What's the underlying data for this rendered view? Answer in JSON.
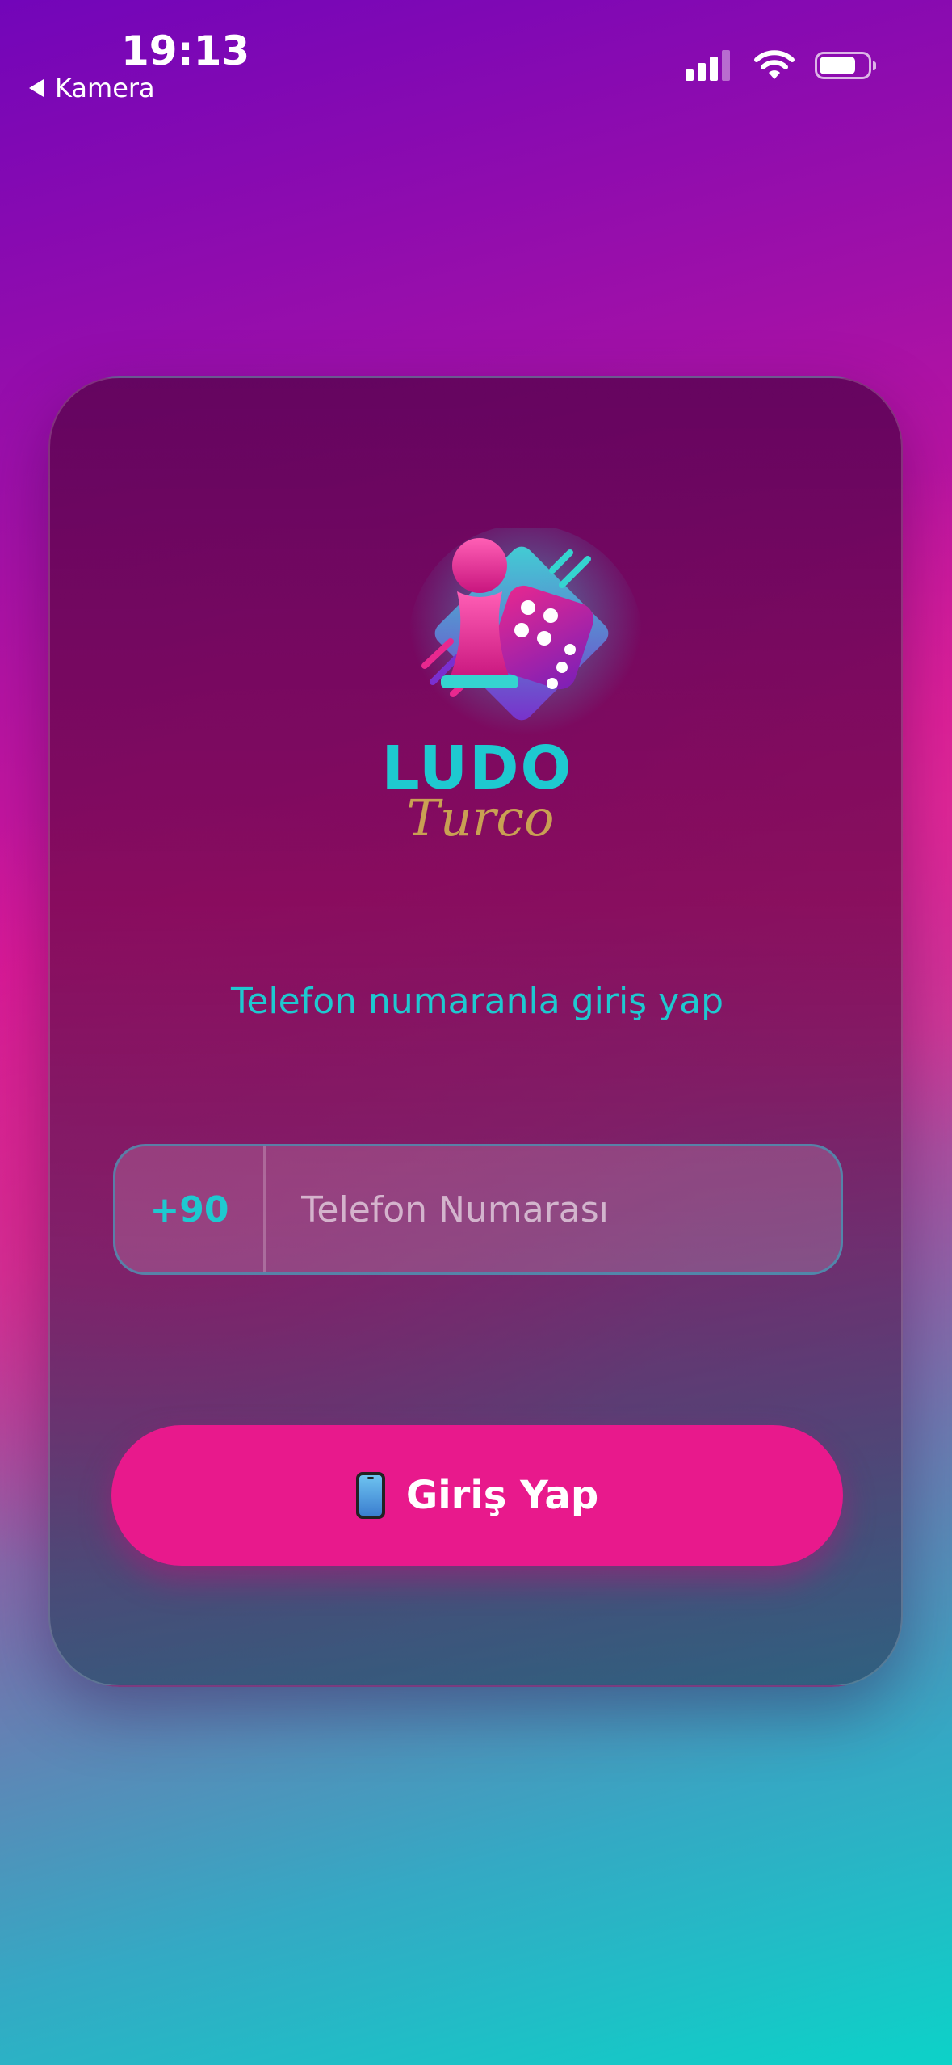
{
  "status_bar": {
    "time": "19:13",
    "back_label": "Kamera"
  },
  "logo": {
    "title": "LUDO",
    "subtitle": "Turco"
  },
  "login": {
    "prompt": "Telefon numaranla giriş yap",
    "country_code": "+90",
    "phone_placeholder": "Telefon Numarası",
    "phone_value": "",
    "button_label": "Giriş Yap",
    "button_icon": "mobile-phone-icon"
  },
  "colors": {
    "accent_teal": "#1ec9d0",
    "button_pink": "#e8198c",
    "logo_gold": "#c9a053"
  }
}
